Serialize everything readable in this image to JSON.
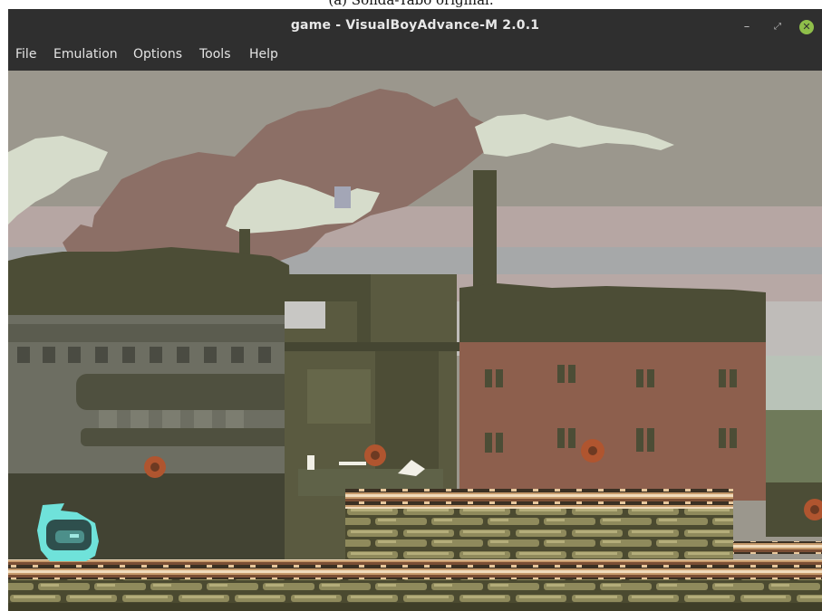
{
  "caption": "(a) Sonda-Tabo original.",
  "window": {
    "title": "game - VisualBoyAdvance-M 2.0.1",
    "controls": {
      "minimize": "–",
      "restore": "⤢",
      "close": "✕"
    }
  },
  "menu": {
    "items": [
      {
        "label": "File"
      },
      {
        "label": "Emulation"
      },
      {
        "label": "Options"
      },
      {
        "label": "Tools"
      },
      {
        "label": "Help"
      }
    ]
  },
  "game": {
    "colors": {
      "sky_top": "#9b978d",
      "sky_band_pink": "#b6a6a3",
      "sky_band_light": "#bfbcb9",
      "cloud_brown": "#8c6f66",
      "cloud_light": "#d6dccb",
      "roof_green": "#4c4d36",
      "building_grey": "#6d6e62",
      "building_brick": "#8d5f4d",
      "building_dark": "#5a5a40",
      "brick_floor": "#c79c6e",
      "player": "#6fe2da"
    }
  }
}
